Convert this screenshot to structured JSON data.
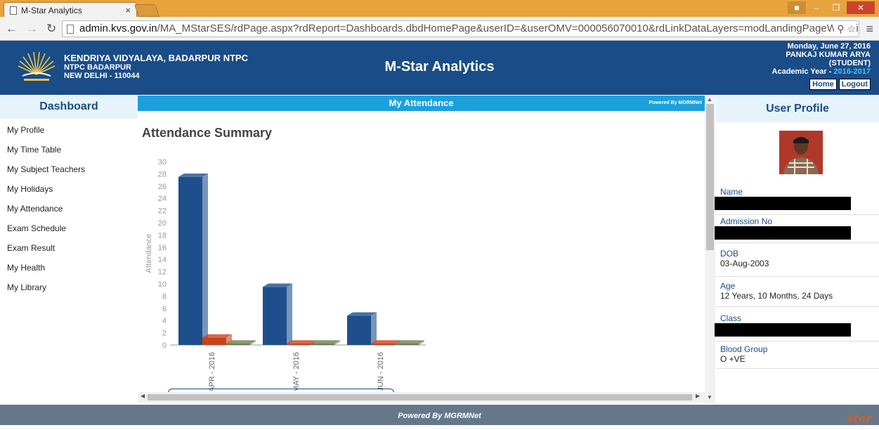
{
  "browser": {
    "tab_title": "M-Star Analytics",
    "tab_close": "×",
    "url_domain": "admin.kvs.gov.in",
    "url_path": "/MA_MStarSES/rdPage.aspx?rdReport=Dashboards.dbdHomePage&userID=&userOMV=000056070010&rdLinkDataLayers=modLandingPageWProfil"
  },
  "header": {
    "school_name": "KENDRIYA VIDYALAYA, BADARPUR NTPC",
    "school_line2": "NTPC BADARPUR",
    "school_line3": "NEW DELHI - 110044",
    "app_title": "M-Star Analytics",
    "date": "Monday, June 27, 2016",
    "user_name": "PANKAJ KUMAR ARYA",
    "user_role": "(STUDENT)",
    "academic_label": "Academic Year - ",
    "academic_year": "2016-2017",
    "home_label": "Home",
    "logout_label": "Logout"
  },
  "sidebar": {
    "title": "Dashboard",
    "items": [
      {
        "label": "My Profile"
      },
      {
        "label": "My Time Table"
      },
      {
        "label": "My Subject Teachers"
      },
      {
        "label": "My Holidays"
      },
      {
        "label": "My Attendance"
      },
      {
        "label": "Exam Schedule"
      },
      {
        "label": "Exam Result"
      },
      {
        "label": "My Health"
      },
      {
        "label": "My Library"
      }
    ]
  },
  "main": {
    "bar_title": "My Attendance",
    "powered_small": "Powered By MGRMNet",
    "summary_title": "Attendance Summary"
  },
  "chart_data": {
    "type": "bar",
    "categories": [
      "APR - 2016",
      "MAY - 2016",
      "JUN - 2016"
    ],
    "series": [
      {
        "values": [
          27.5,
          9.5,
          4.8
        ],
        "color": "#1e4f8c"
      },
      {
        "values": [
          1.2,
          0,
          0
        ],
        "color": "#c9431e"
      },
      {
        "values": [
          0,
          0,
          0
        ],
        "color": "#6e7f52"
      }
    ],
    "ylabel": "Attendance",
    "ylim": [
      0,
      30
    ],
    "yticks": [
      "0",
      "2",
      "4",
      "6",
      "8",
      "10",
      "12",
      "14",
      "16",
      "18",
      "20",
      "22",
      "24",
      "26",
      "28",
      "30"
    ]
  },
  "profile": {
    "title": "User Profile",
    "name_label": "Name",
    "admission_label": "Admission No",
    "dob_label": "DOB",
    "dob_value": "03-Aug-2003",
    "age_label": "Age",
    "age_value": "12 Years, 10 Months, 24 Days",
    "class_label": "Class",
    "blood_label": "Blood Group",
    "blood_value": "O +VE"
  },
  "footer": {
    "text": "Powered By MGRMNet",
    "logo_text": "star"
  }
}
